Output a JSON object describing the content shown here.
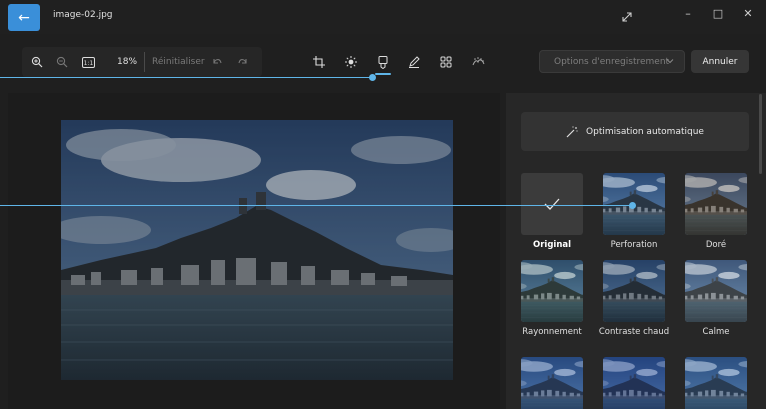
{
  "titlebar": {
    "file_name": "image-02.jpg"
  },
  "toolbar": {
    "zoom_percent": "18%",
    "reset_label": "Réinitialiser"
  },
  "actions": {
    "save_options_label": "Options d'enregistrement",
    "cancel_label": "Annuler"
  },
  "panel": {
    "auto_enhance_label": "Optimisation automatique",
    "filters": [
      {
        "label": "Original"
      },
      {
        "label": "Perforation"
      },
      {
        "label": "Doré"
      },
      {
        "label": "Rayonnement"
      },
      {
        "label": "Contraste chaud"
      },
      {
        "label": "Calme"
      }
    ]
  },
  "colors": {
    "accent": "#3a8fd9",
    "pointer": "#5fb5e8"
  }
}
